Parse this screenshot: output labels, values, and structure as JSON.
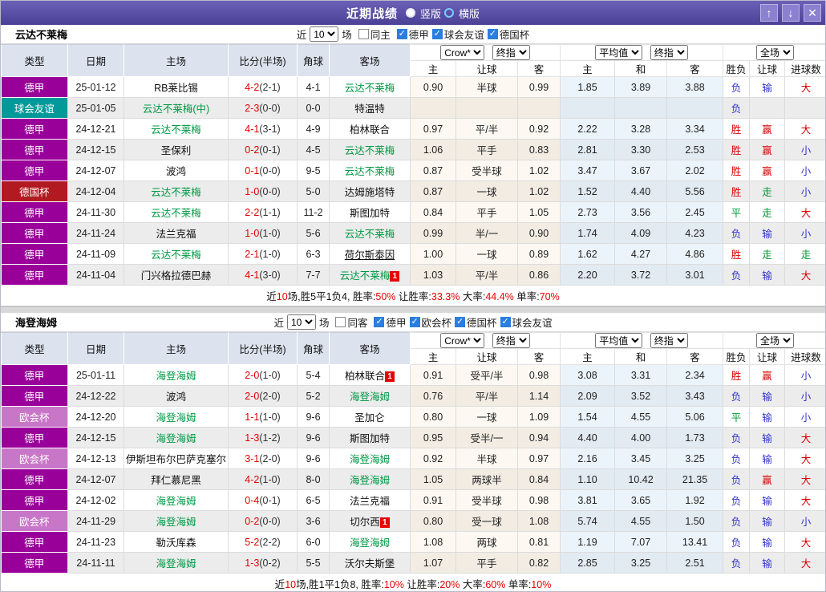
{
  "titlebar": {
    "title": "近期战绩",
    "radio_vertical": "竖版",
    "radio_horizontal": "横版",
    "icons": {
      "up": "↑",
      "down": "↓",
      "close": "✕"
    }
  },
  "header": {
    "cols": [
      "类型",
      "日期",
      "主场",
      "比分(半场)",
      "角球",
      "客场"
    ],
    "sub": [
      "主",
      "让球",
      "客",
      "主",
      "和",
      "客",
      "胜负",
      "让球",
      "进球数"
    ],
    "selects": {
      "company": "Crow*",
      "final1": "终指",
      "avg": "平均值",
      "final2": "终指",
      "fulltime": "全场"
    }
  },
  "comp_colors": {
    "德甲": "#990099",
    "球会友谊": "#009999",
    "德国杯": "#b11a20",
    "欧会杯": "#c876c8"
  },
  "result_colors": {
    "胜": "#d80000",
    "平": "#009933",
    "负": "#3333cc",
    "赢": "#d80000",
    "走": "#009933",
    "输": "#3333cc",
    "大": "#d80000",
    "小": "#3333cc"
  },
  "teams": [
    {
      "name": "云达不莱梅",
      "filter": {
        "prefix": "近",
        "count": "10",
        "suffix": "场",
        "same_label": "同主",
        "same_checked": false,
        "leagues": [
          {
            "label": "德甲",
            "checked": true
          },
          {
            "label": "球会友谊",
            "checked": true
          },
          {
            "label": "德国杯",
            "checked": true
          }
        ]
      },
      "rows": [
        {
          "comp": "德甲",
          "date": "25-01-12",
          "home": "RB莱比锡",
          "home_green": false,
          "home_badge": "",
          "score": "4-2",
          "half": "(2-1)",
          "corner": "4-1",
          "away": "云达不莱梅",
          "away_green": true,
          "away_badge": "",
          "away_underline": false,
          "hc": [
            "0.90",
            "半球",
            "0.99"
          ],
          "avg": [
            "1.85",
            "3.89",
            "3.88"
          ],
          "res": [
            "负",
            "输",
            "大"
          ]
        },
        {
          "comp": "球会友谊",
          "date": "25-01-05",
          "home": "云达不莱梅(中)",
          "home_green": true,
          "home_badge": "",
          "score": "2-3",
          "half": "(0-0)",
          "corner": "0-0",
          "away": "特温特",
          "away_green": false,
          "away_badge": "",
          "away_underline": false,
          "hc": [
            "",
            "",
            ""
          ],
          "avg": [
            "",
            "",
            ""
          ],
          "res": [
            "负",
            "",
            ""
          ]
        },
        {
          "comp": "德甲",
          "date": "24-12-21",
          "home": "云达不莱梅",
          "home_green": true,
          "home_badge": "",
          "score": "4-1",
          "half": "(3-1)",
          "corner": "4-9",
          "away": "柏林联合",
          "away_green": false,
          "away_badge": "",
          "away_underline": false,
          "hc": [
            "0.97",
            "平/半",
            "0.92"
          ],
          "avg": [
            "2.22",
            "3.28",
            "3.34"
          ],
          "res": [
            "胜",
            "赢",
            "大"
          ]
        },
        {
          "comp": "德甲",
          "date": "24-12-15",
          "home": "圣保利",
          "home_green": false,
          "home_badge": "",
          "score": "0-2",
          "half": "(0-1)",
          "corner": "4-5",
          "away": "云达不莱梅",
          "away_green": true,
          "away_badge": "",
          "away_underline": false,
          "hc": [
            "1.06",
            "平手",
            "0.83"
          ],
          "avg": [
            "2.81",
            "3.30",
            "2.53"
          ],
          "res": [
            "胜",
            "赢",
            "小"
          ]
        },
        {
          "comp": "德甲",
          "date": "24-12-07",
          "home": "波鸿",
          "home_green": false,
          "home_badge": "",
          "score": "0-1",
          "half": "(0-0)",
          "corner": "9-5",
          "away": "云达不莱梅",
          "away_green": true,
          "away_badge": "",
          "away_underline": false,
          "hc": [
            "0.87",
            "受半球",
            "1.02"
          ],
          "avg": [
            "3.47",
            "3.67",
            "2.02"
          ],
          "res": [
            "胜",
            "赢",
            "小"
          ]
        },
        {
          "comp": "德国杯",
          "date": "24-12-04",
          "home": "云达不莱梅",
          "home_green": true,
          "home_badge": "",
          "score": "1-0",
          "half": "(0-0)",
          "corner": "5-0",
          "away": "达姆施塔特",
          "away_green": false,
          "away_badge": "",
          "away_underline": false,
          "hc": [
            "0.87",
            "一球",
            "1.02"
          ],
          "avg": [
            "1.52",
            "4.40",
            "5.56"
          ],
          "res": [
            "胜",
            "走",
            "小"
          ]
        },
        {
          "comp": "德甲",
          "date": "24-11-30",
          "home": "云达不莱梅",
          "home_green": true,
          "home_badge": "",
          "score": "2-2",
          "half": "(1-1)",
          "corner": "11-2",
          "away": "斯图加特",
          "away_green": false,
          "away_badge": "",
          "away_underline": false,
          "hc": [
            "0.84",
            "平手",
            "1.05"
          ],
          "avg": [
            "2.73",
            "3.56",
            "2.45"
          ],
          "res": [
            "平",
            "走",
            "大"
          ]
        },
        {
          "comp": "德甲",
          "date": "24-11-24",
          "home": "法兰克福",
          "home_green": false,
          "home_badge": "",
          "score": "1-0",
          "half": "(1-0)",
          "corner": "5-6",
          "away": "云达不莱梅",
          "away_green": true,
          "away_badge": "",
          "away_underline": false,
          "hc": [
            "0.99",
            "半/一",
            "0.90"
          ],
          "avg": [
            "1.74",
            "4.09",
            "4.23"
          ],
          "res": [
            "负",
            "输",
            "小"
          ]
        },
        {
          "comp": "德甲",
          "date": "24-11-09",
          "home": "云达不莱梅",
          "home_green": true,
          "home_badge": "",
          "score": "2-1",
          "half": "(1-0)",
          "corner": "6-3",
          "away": "荷尔斯泰因",
          "away_green": false,
          "away_badge": "",
          "away_underline": true,
          "hc": [
            "1.00",
            "一球",
            "0.89"
          ],
          "avg": [
            "1.62",
            "4.27",
            "4.86"
          ],
          "res": [
            "胜",
            "走",
            "走"
          ]
        },
        {
          "comp": "德甲",
          "date": "24-11-04",
          "home": "门兴格拉德巴赫",
          "home_green": false,
          "home_badge": "",
          "score": "4-1",
          "half": "(3-0)",
          "corner": "7-7",
          "away": "云达不莱梅",
          "away_green": true,
          "away_badge": "1",
          "away_underline": false,
          "hc": [
            "1.03",
            "平/半",
            "0.86"
          ],
          "avg": [
            "2.20",
            "3.72",
            "3.01"
          ],
          "res": [
            "负",
            "输",
            "大"
          ]
        }
      ],
      "summary": [
        {
          "t": "近",
          "r": false
        },
        {
          "t": "10",
          "r": true
        },
        {
          "t": "场,胜5平1负4, 胜率:",
          "r": false
        },
        {
          "t": "50%",
          "r": true
        },
        {
          "t": " 让胜率:",
          "r": false
        },
        {
          "t": "33.3%",
          "r": true
        },
        {
          "t": " 大率:",
          "r": false
        },
        {
          "t": "44.4%",
          "r": true
        },
        {
          "t": " 单率:",
          "r": false
        },
        {
          "t": "70%",
          "r": true
        }
      ]
    },
    {
      "name": "海登海姆",
      "filter": {
        "prefix": "近",
        "count": "10",
        "suffix": "场",
        "same_label": "同客",
        "same_checked": false,
        "leagues": [
          {
            "label": "德甲",
            "checked": true
          },
          {
            "label": "欧会杯",
            "checked": true
          },
          {
            "label": "德国杯",
            "checked": true
          },
          {
            "label": "球会友谊",
            "checked": true
          }
        ]
      },
      "rows": [
        {
          "comp": "德甲",
          "date": "25-01-11",
          "home": "海登海姆",
          "home_green": true,
          "home_badge": "",
          "score": "2-0",
          "half": "(1-0)",
          "corner": "5-4",
          "away": "柏林联合",
          "away_green": false,
          "away_badge": "1",
          "away_underline": false,
          "hc": [
            "0.91",
            "受平/半",
            "0.98"
          ],
          "avg": [
            "3.08",
            "3.31",
            "2.34"
          ],
          "res": [
            "胜",
            "赢",
            "小"
          ]
        },
        {
          "comp": "德甲",
          "date": "24-12-22",
          "home": "波鸿",
          "home_green": false,
          "home_badge": "",
          "score": "2-0",
          "half": "(2-0)",
          "corner": "5-2",
          "away": "海登海姆",
          "away_green": true,
          "away_badge": "",
          "away_underline": false,
          "hc": [
            "0.76",
            "平/半",
            "1.14"
          ],
          "avg": [
            "2.09",
            "3.52",
            "3.43"
          ],
          "res": [
            "负",
            "输",
            "小"
          ]
        },
        {
          "comp": "欧会杯",
          "date": "24-12-20",
          "home": "海登海姆",
          "home_green": true,
          "home_badge": "",
          "score": "1-1",
          "half": "(1-0)",
          "corner": "9-6",
          "away": "圣加仑",
          "away_green": false,
          "away_badge": "",
          "away_underline": false,
          "hc": [
            "0.80",
            "一球",
            "1.09"
          ],
          "avg": [
            "1.54",
            "4.55",
            "5.06"
          ],
          "res": [
            "平",
            "输",
            "小"
          ]
        },
        {
          "comp": "德甲",
          "date": "24-12-15",
          "home": "海登海姆",
          "home_green": true,
          "home_badge": "",
          "score": "1-3",
          "half": "(1-2)",
          "corner": "9-6",
          "away": "斯图加特",
          "away_green": false,
          "away_badge": "",
          "away_underline": false,
          "hc": [
            "0.95",
            "受半/一",
            "0.94"
          ],
          "avg": [
            "4.40",
            "4.00",
            "1.73"
          ],
          "res": [
            "负",
            "输",
            "大"
          ]
        },
        {
          "comp": "欧会杯",
          "date": "24-12-13",
          "home": "伊斯坦布尔巴萨克塞尔",
          "home_green": false,
          "home_badge": "",
          "score": "3-1",
          "half": "(2-0)",
          "corner": "9-6",
          "away": "海登海姆",
          "away_green": true,
          "away_badge": "",
          "away_underline": false,
          "hc": [
            "0.92",
            "半球",
            "0.97"
          ],
          "avg": [
            "2.16",
            "3.45",
            "3.25"
          ],
          "res": [
            "负",
            "输",
            "大"
          ]
        },
        {
          "comp": "德甲",
          "date": "24-12-07",
          "home": "拜仁慕尼黑",
          "home_green": false,
          "home_badge": "",
          "score": "4-2",
          "half": "(1-0)",
          "corner": "8-0",
          "away": "海登海姆",
          "away_green": true,
          "away_badge": "",
          "away_underline": false,
          "hc": [
            "1.05",
            "两球半",
            "0.84"
          ],
          "avg": [
            "1.10",
            "10.42",
            "21.35"
          ],
          "res": [
            "负",
            "赢",
            "大"
          ]
        },
        {
          "comp": "德甲",
          "date": "24-12-02",
          "home": "海登海姆",
          "home_green": true,
          "home_badge": "",
          "score": "0-4",
          "half": "(0-1)",
          "corner": "6-5",
          "away": "法兰克福",
          "away_green": false,
          "away_badge": "",
          "away_underline": false,
          "hc": [
            "0.91",
            "受半球",
            "0.98"
          ],
          "avg": [
            "3.81",
            "3.65",
            "1.92"
          ],
          "res": [
            "负",
            "输",
            "大"
          ]
        },
        {
          "comp": "欧会杯",
          "date": "24-11-29",
          "home": "海登海姆",
          "home_green": true,
          "home_badge": "",
          "score": "0-2",
          "half": "(0-0)",
          "corner": "3-6",
          "away": "切尔西",
          "away_green": false,
          "away_badge": "1",
          "away_underline": false,
          "hc": [
            "0.80",
            "受一球",
            "1.08"
          ],
          "avg": [
            "5.74",
            "4.55",
            "1.50"
          ],
          "res": [
            "负",
            "输",
            "小"
          ]
        },
        {
          "comp": "德甲",
          "date": "24-11-23",
          "home": "勒沃库森",
          "home_green": false,
          "home_badge": "",
          "score": "5-2",
          "half": "(2-2)",
          "corner": "6-0",
          "away": "海登海姆",
          "away_green": true,
          "away_badge": "",
          "away_underline": false,
          "hc": [
            "1.08",
            "两球",
            "0.81"
          ],
          "avg": [
            "1.19",
            "7.07",
            "13.41"
          ],
          "res": [
            "负",
            "输",
            "大"
          ]
        },
        {
          "comp": "德甲",
          "date": "24-11-11",
          "home": "海登海姆",
          "home_green": true,
          "home_badge": "",
          "score": "1-3",
          "half": "(0-2)",
          "corner": "5-5",
          "away": "沃尔夫斯堡",
          "away_green": false,
          "away_badge": "",
          "away_underline": false,
          "hc": [
            "1.07",
            "平手",
            "0.82"
          ],
          "avg": [
            "2.85",
            "3.25",
            "2.51"
          ],
          "res": [
            "负",
            "输",
            "大"
          ]
        }
      ],
      "summary": [
        {
          "t": "近",
          "r": false
        },
        {
          "t": "10",
          "r": true
        },
        {
          "t": "场,胜1平1负8, 胜率:",
          "r": false
        },
        {
          "t": "10%",
          "r": true
        },
        {
          "t": " 让胜率:",
          "r": false
        },
        {
          "t": "20%",
          "r": true
        },
        {
          "t": " 大率:",
          "r": false
        },
        {
          "t": "60%",
          "r": true
        },
        {
          "t": " 单率:",
          "r": false
        },
        {
          "t": "10%",
          "r": true
        }
      ]
    }
  ]
}
